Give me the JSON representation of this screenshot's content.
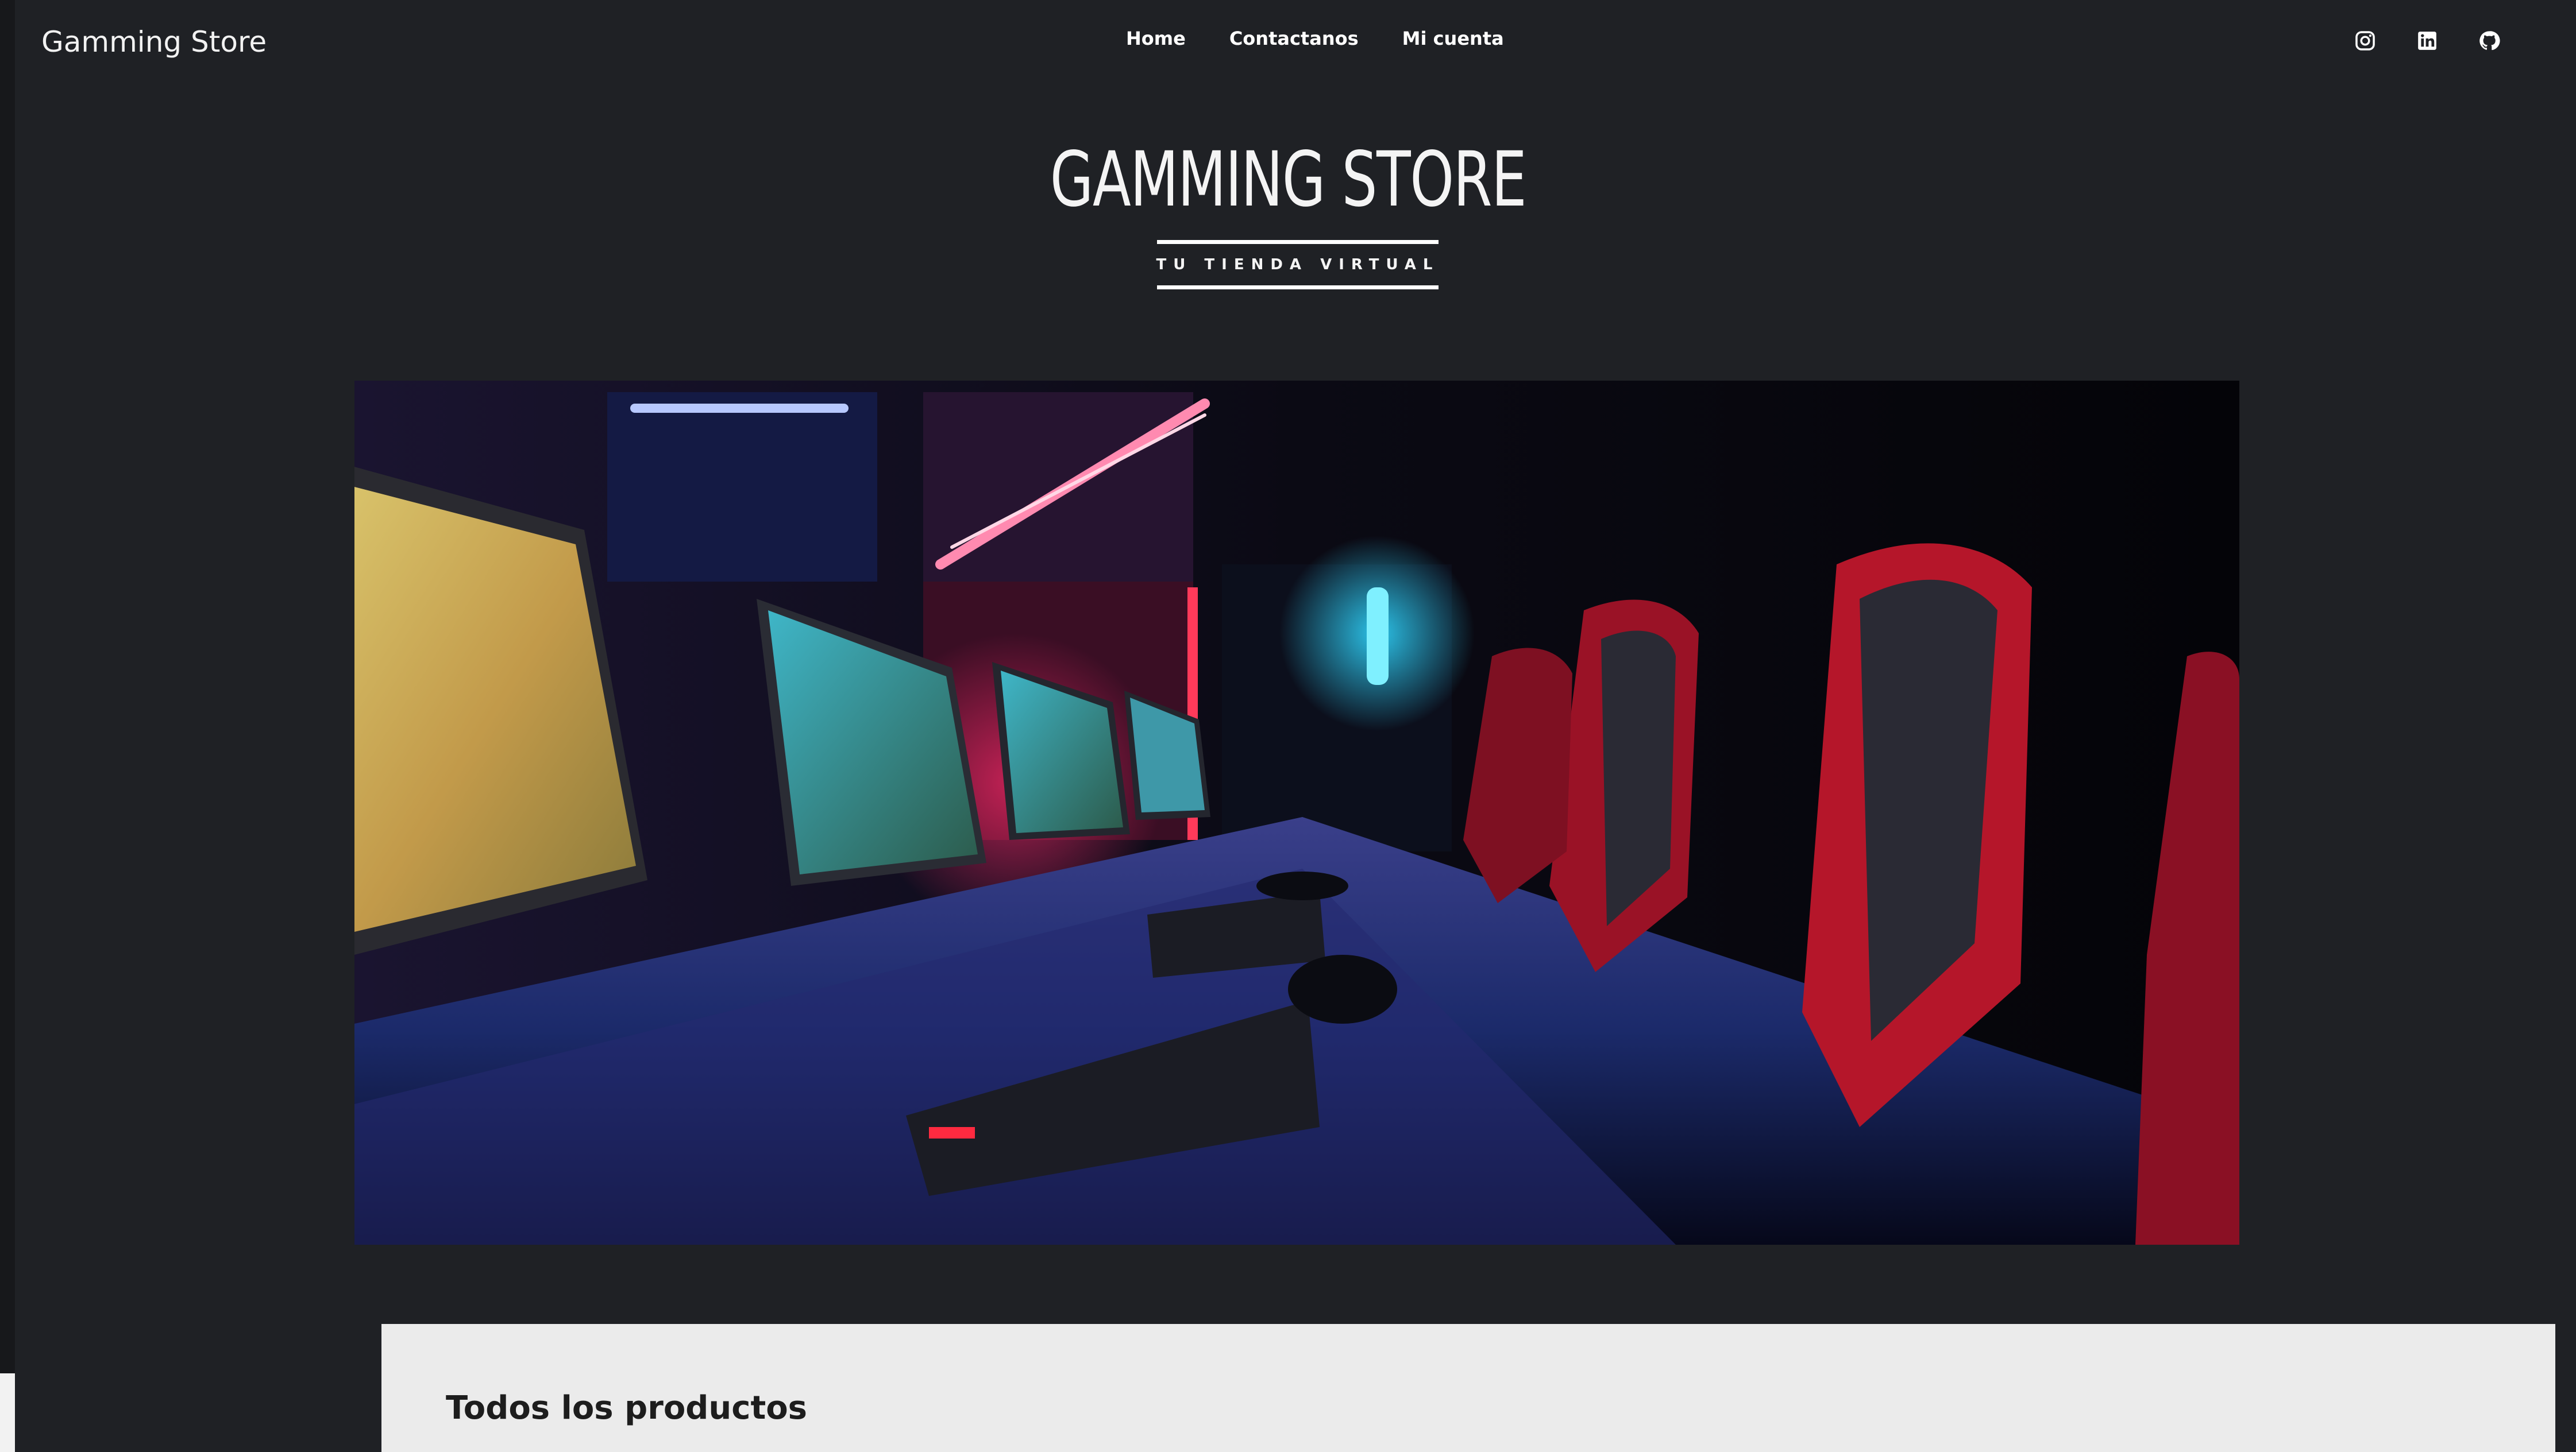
{
  "navbar": {
    "brand": "Gamming Store",
    "links": [
      "Home",
      "Contactanos",
      "Mi cuenta"
    ],
    "social_icons": [
      "instagram-icon",
      "linkedin-icon",
      "github-icon"
    ]
  },
  "hero": {
    "title": "GAMMING STORE",
    "subtitle": "TU TIENDA VIRTUAL"
  },
  "banner": {
    "image": "gaming-room-photo"
  },
  "products": {
    "heading": "Todos los productos"
  },
  "colors": {
    "background": "#1f2125",
    "panel": "#ebebeb",
    "text": "#ffffff"
  }
}
